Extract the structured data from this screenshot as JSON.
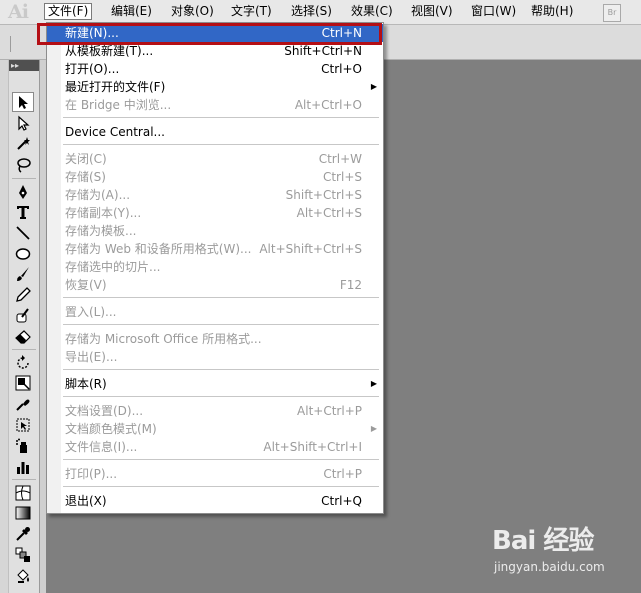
{
  "app": {
    "logo": "Ai"
  },
  "menubar": {
    "items": [
      {
        "label": "文件(F)",
        "active": true
      },
      {
        "label": "编辑(E)"
      },
      {
        "label": "对象(O)"
      },
      {
        "label": "文字(T)"
      },
      {
        "label": "选择(S)"
      },
      {
        "label": "效果(C)"
      },
      {
        "label": "视图(V)"
      },
      {
        "label": "窗口(W)"
      },
      {
        "label": "帮助(H)"
      }
    ],
    "bridge_button": "Br"
  },
  "tools_panel": {
    "header": "▸▸"
  },
  "file_menu": {
    "items": [
      {
        "label": "新建(N)...",
        "shortcut": "Ctrl+N",
        "highlighted": true
      },
      {
        "label": "从模板新建(T)...",
        "shortcut": "Shift+Ctrl+N"
      },
      {
        "label": "打开(O)...",
        "shortcut": "Ctrl+O"
      },
      {
        "label": "最近打开的文件(F)",
        "submenu": true
      },
      {
        "label": "在 Bridge 中浏览...",
        "shortcut": "Alt+Ctrl+O",
        "disabled": true
      },
      {
        "label": "Device Central..."
      },
      {
        "label": "关闭(C)",
        "shortcut": "Ctrl+W",
        "disabled": true
      },
      {
        "label": "存储(S)",
        "shortcut": "Ctrl+S",
        "disabled": true
      },
      {
        "label": "存储为(A)...",
        "shortcut": "Shift+Ctrl+S",
        "disabled": true
      },
      {
        "label": "存储副本(Y)...",
        "shortcut": "Alt+Ctrl+S",
        "disabled": true
      },
      {
        "label": "存储为模板...",
        "disabled": true
      },
      {
        "label": "存储为 Web 和设备所用格式(W)...",
        "shortcut": "Alt+Shift+Ctrl+S",
        "disabled": true
      },
      {
        "label": "存储选中的切片...",
        "disabled": true
      },
      {
        "label": "恢复(V)",
        "shortcut": "F12",
        "disabled": true
      },
      {
        "label": "置入(L)...",
        "disabled": true
      },
      {
        "label": "存储为 Microsoft Office 所用格式...",
        "disabled": true
      },
      {
        "label": "导出(E)...",
        "disabled": true
      },
      {
        "label": "脚本(R)",
        "submenu": true
      },
      {
        "label": "文档设置(D)...",
        "shortcut": "Alt+Ctrl+P",
        "disabled": true
      },
      {
        "label": "文档颜色模式(M)",
        "submenu": true,
        "disabled": true
      },
      {
        "label": "文件信息(I)...",
        "shortcut": "Alt+Shift+Ctrl+I",
        "disabled": true
      },
      {
        "label": "打印(P)...",
        "shortcut": "Ctrl+P",
        "disabled": true
      },
      {
        "label": "退出(X)",
        "shortcut": "Ctrl+Q"
      }
    ]
  },
  "watermark": {
    "logo": "Bai 经验",
    "url": "jingyan.baidu.com"
  },
  "colors": {
    "highlight": "#3167c6",
    "frame": "#b40f15",
    "workspace": "#7f7f7f"
  }
}
